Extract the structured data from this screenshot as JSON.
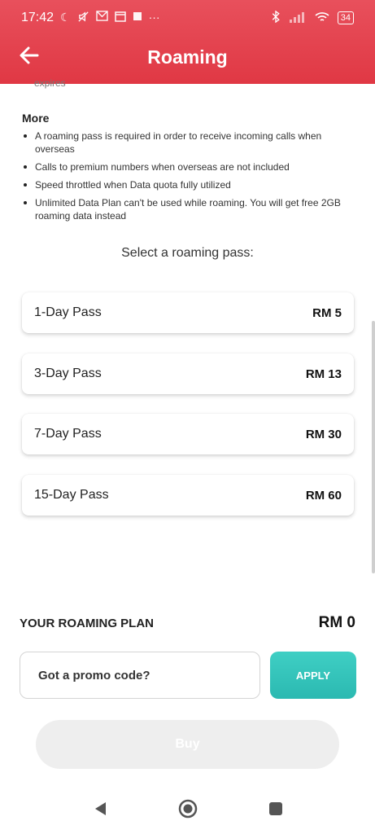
{
  "status_bar": {
    "time": "17:42",
    "left_icons": [
      "moon-icon",
      "mute-icon",
      "mail-icon",
      "calendar-icon",
      "square-icon",
      "more-dots-icon"
    ],
    "battery": "34",
    "right_icons": [
      "bluetooth-icon",
      "signal-icon",
      "wifi-icon",
      "battery-icon"
    ]
  },
  "header": {
    "title": "Roaming",
    "back_icon": "arrow-left-icon",
    "color": "#e03844"
  },
  "expires_fragment": "expires",
  "more": {
    "title": "More",
    "items": [
      "A roaming pass is required in order to receive incoming calls when overseas",
      "Calls to premium numbers when overseas are not included",
      "Speed throttled when Data quota fully utilized",
      "Unlimited Data Plan can't be used while roaming. You will get free 2GB roaming data instead"
    ]
  },
  "select_label": "Select a roaming pass:",
  "passes": [
    {
      "name": "1-Day Pass",
      "price": "RM 5"
    },
    {
      "name": "3-Day Pass",
      "price": "RM 13"
    },
    {
      "name": "7-Day Pass",
      "price": "RM 30"
    },
    {
      "name": "15-Day Pass",
      "price": "RM 60"
    }
  ],
  "plan": {
    "label": "YOUR ROAMING PLAN",
    "price": "RM 0"
  },
  "promo": {
    "placeholder": "Got a promo code?",
    "value": "",
    "apply_label": "APPLY",
    "apply_color": "#2bb9b1"
  },
  "buy_label": "Buy",
  "nav": {
    "icons": [
      "back-triangle-icon",
      "home-circle-icon",
      "recents-square-icon"
    ]
  }
}
